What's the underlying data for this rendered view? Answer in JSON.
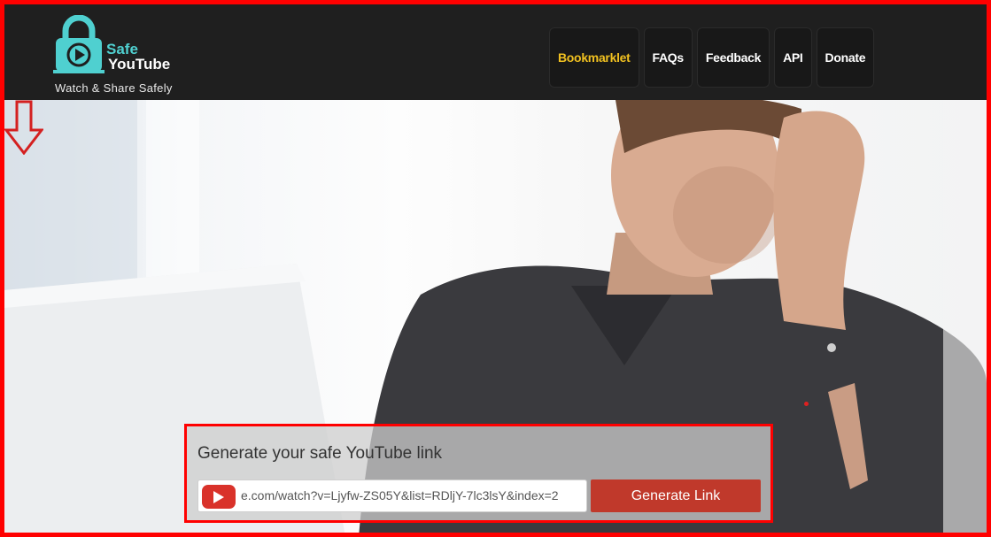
{
  "brand": {
    "name_line1": "Safe",
    "name_line2": "YouTube",
    "tagline": "Watch & Share Safely",
    "icon": "padlock-play-icon",
    "accent_color": "#4fd0d0"
  },
  "nav": {
    "items": [
      {
        "label": "Bookmarklet",
        "active": true
      },
      {
        "label": "FAQs"
      },
      {
        "label": "Feedback"
      },
      {
        "label": "API"
      },
      {
        "label": "Donate"
      }
    ],
    "active_color": "#f0c020"
  },
  "hero": {
    "annotation_icon": "down-arrow-icon"
  },
  "generator": {
    "title": "Generate your safe YouTube link",
    "url_value": "e.com/watch?v=Ljyfw-ZS05Y&list=RDljY-7lc3lsY&index=2",
    "input_icon": "youtube-play-icon",
    "button_label": "Generate Link",
    "button_color": "#c0392b"
  },
  "highlight_color": "#ff0000"
}
